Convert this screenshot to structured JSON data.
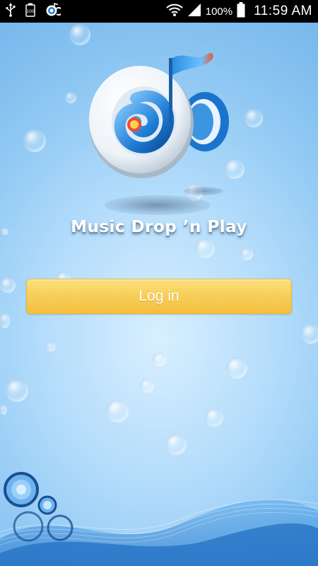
{
  "status_bar": {
    "battery_percent": "100%",
    "time": "11:59 AM",
    "notification_badge": "100"
  },
  "app": {
    "name": "Music Drop ’n Play",
    "login_label": "Log in"
  },
  "colors": {
    "button_yellow": "#f8cf5a",
    "background_blue": "#8cc6f2",
    "status_bar": "#000000"
  }
}
